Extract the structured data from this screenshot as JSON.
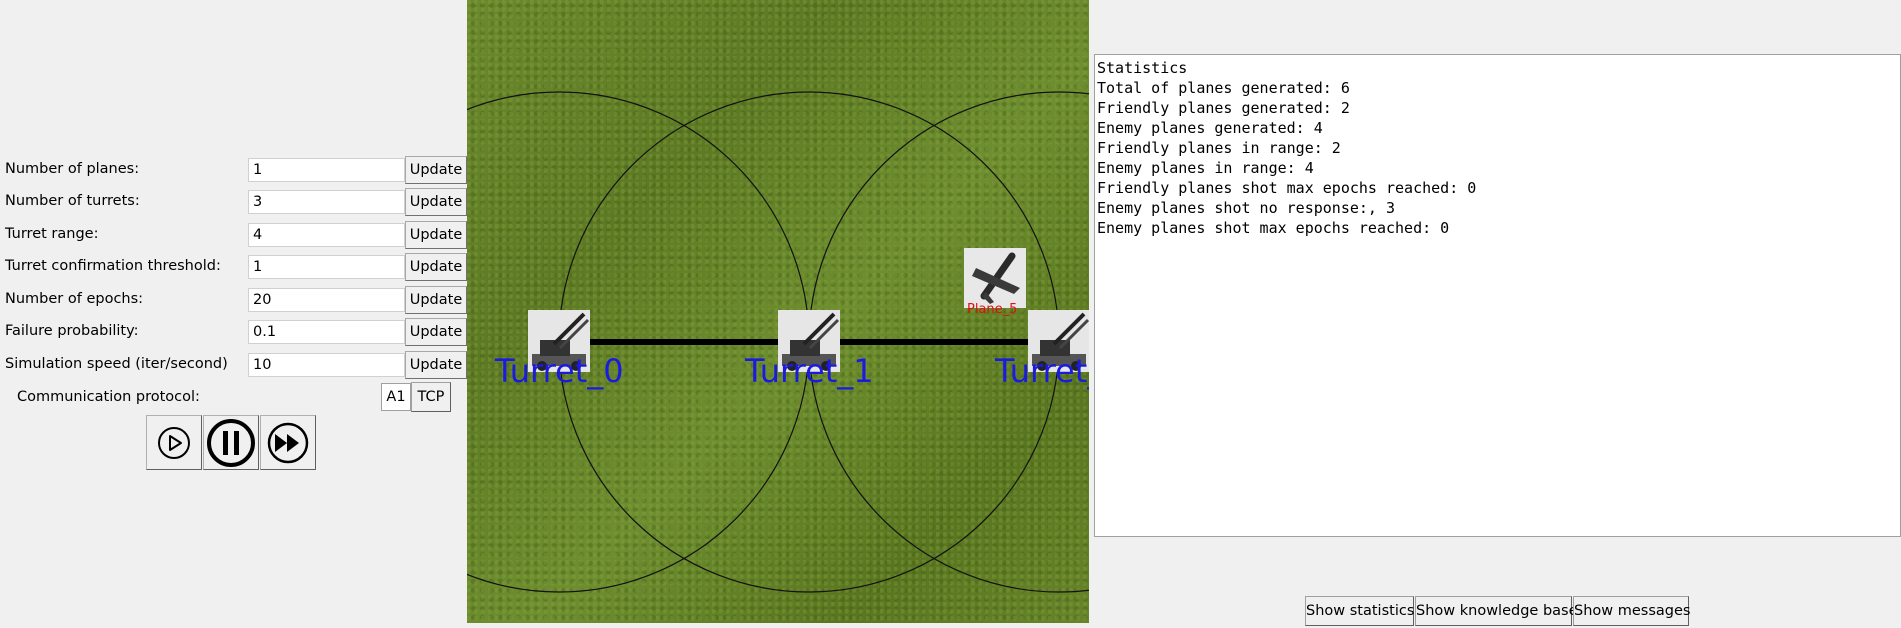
{
  "settings": [
    {
      "label": "Number of planes:",
      "value": "1",
      "button": "Update"
    },
    {
      "label": "Number of turrets:",
      "value": "3",
      "button": "Update"
    },
    {
      "label": "Turret range:",
      "value": "4",
      "button": "Update"
    },
    {
      "label": "Turret confirmation threshold:",
      "value": "1",
      "button": "Update"
    },
    {
      "label": "Number of epochs:",
      "value": "20",
      "button": "Update"
    },
    {
      "label": "Failure probability:",
      "value": "0.1",
      "button": "Update"
    },
    {
      "label": "Simulation speed (iter/second)",
      "value": "10",
      "button": "Update"
    }
  ],
  "protocol": {
    "label": "Communication protocol:",
    "options": [
      "A1",
      "TCP"
    ],
    "selected": "A1"
  },
  "controls": {
    "play_icon": "play-icon",
    "pause_icon": "pause-icon",
    "fast_forward_icon": "fast-forward-icon"
  },
  "field": {
    "turrets": [
      {
        "name": "Turret_0",
        "icon": "anti-aircraft-turret-icon"
      },
      {
        "name": "Turret_1",
        "icon": "anti-aircraft-turret-icon"
      },
      {
        "name": "Turret_",
        "icon": "anti-aircraft-turret-icon"
      }
    ],
    "planes": [
      {
        "name": "Plane_5",
        "icon": "fighter-plane-icon"
      }
    ],
    "colors": {
      "turret_label": "#1a1ae0",
      "plane_label": "#e01010",
      "grass": "#62802a"
    }
  },
  "statistics": {
    "lines": [
      "Statistics",
      "Total of planes generated: 6",
      "Friendly planes generated: 2",
      "Enemy planes generated: 4",
      "Friendly planes in range: 2",
      "Enemy planes in range: 4",
      "Friendly planes shot max epochs reached: 0",
      "Enemy planes shot no response:, 3",
      "Enemy planes shot max epochs reached: 0"
    ]
  },
  "bottom_tabs": {
    "show_statistics": "Show statistics",
    "show_knowledge_base": "Show knowledge base",
    "show_messages": "Show messages"
  }
}
